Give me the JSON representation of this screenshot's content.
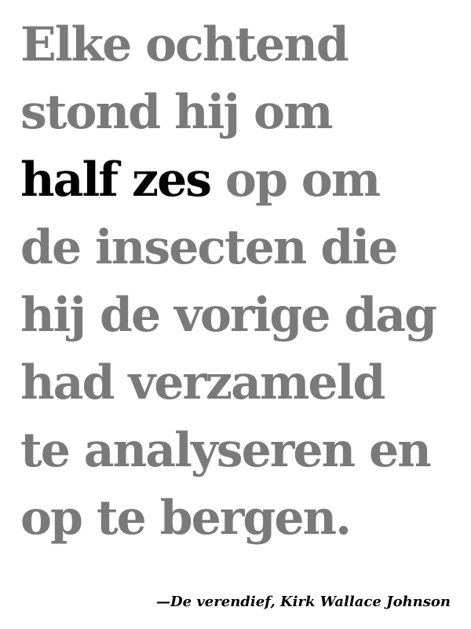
{
  "quote": {
    "line1": "Elke ochtend",
    "line2": "stond hij om",
    "line3_emphasis": "half zes",
    "line3_rest": " op om",
    "line4": "de insecten die",
    "line5": "hij de vorige dag",
    "line6": "had verzameld",
    "line7": "te analyseren en",
    "line8": "op te bergen."
  },
  "attribution": "—De verendief, Kirk Wallace Johnson",
  "colors": {
    "text_muted": "#7a7a7a",
    "text_emphasis": "#000000",
    "background": "#ffffff"
  }
}
